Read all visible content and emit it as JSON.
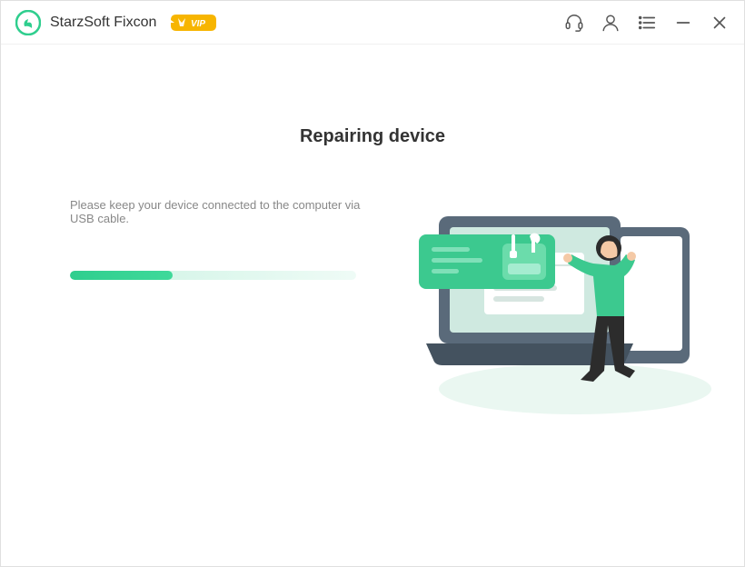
{
  "titlebar": {
    "app_name": "StarzSoft Fixcon",
    "vip_label": "VIP"
  },
  "main": {
    "heading": "Repairing device",
    "instruction": "Please keep your device connected to the computer via USB cable.",
    "progress_percent": 36
  },
  "colors": {
    "accent": "#2fce8e",
    "vip_bg": "#f7b500",
    "text_primary": "#333333",
    "text_secondary": "#888888"
  }
}
